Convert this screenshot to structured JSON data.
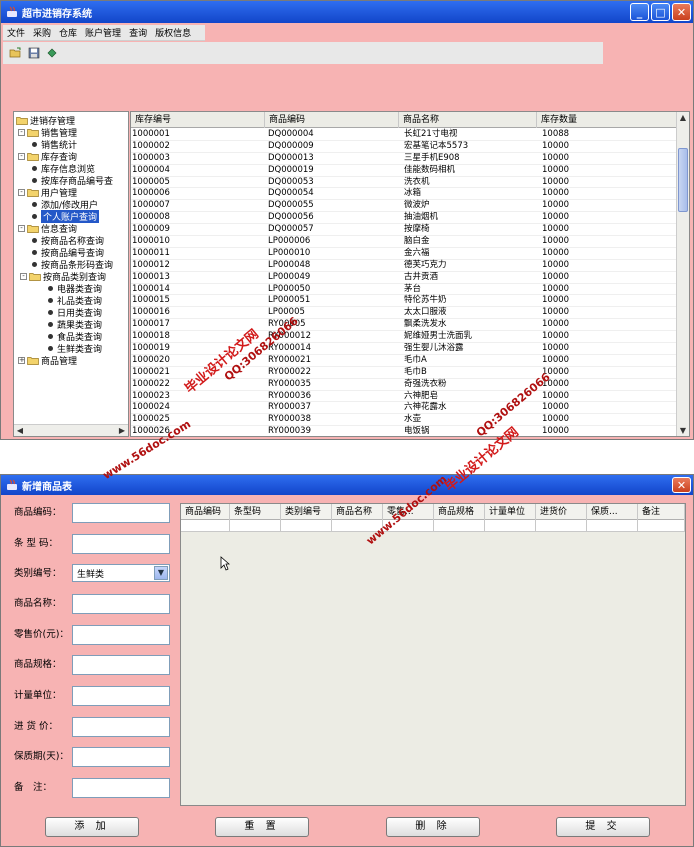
{
  "main_window": {
    "title": "超市进销存系统",
    "menu": [
      "文件",
      "采购",
      "仓库",
      "账户管理",
      "查询",
      "版权信息"
    ],
    "toolbar_icons": [
      "open-folder-icon",
      "save-icon",
      "refresh-icon"
    ],
    "tree": [
      {
        "label": "进销存管理",
        "level": 0,
        "type": "folder",
        "toggle": ""
      },
      {
        "label": "销售管理",
        "level": 1,
        "type": "folder",
        "toggle": "-"
      },
      {
        "label": "销售统计",
        "level": 2,
        "type": "leaf"
      },
      {
        "label": "库存查询",
        "level": 1,
        "type": "folder",
        "toggle": "-"
      },
      {
        "label": "库存信息浏览",
        "level": 2,
        "type": "leaf"
      },
      {
        "label": "按库存商品编号查",
        "level": 2,
        "type": "leaf"
      },
      {
        "label": "用户管理",
        "level": 1,
        "type": "folder",
        "toggle": "-"
      },
      {
        "label": "添加/修改用户",
        "level": 2,
        "type": "leaf"
      },
      {
        "label": "个人账户查询",
        "level": 2,
        "type": "leaf",
        "selected": true
      },
      {
        "label": "信息查询",
        "level": 1,
        "type": "folder",
        "toggle": "-"
      },
      {
        "label": "按商品名称查询",
        "level": 2,
        "type": "leaf"
      },
      {
        "label": "按商品编号查询",
        "level": 2,
        "type": "leaf"
      },
      {
        "label": "按商品条形码查询",
        "level": 2,
        "type": "leaf"
      },
      {
        "label": "按商品类别查询",
        "level": 2,
        "type": "folder",
        "toggle": "-"
      },
      {
        "label": "电器类查询",
        "level": 3,
        "type": "leaf"
      },
      {
        "label": "礼品类查询",
        "level": 3,
        "type": "leaf"
      },
      {
        "label": "日用类查询",
        "level": 3,
        "type": "leaf"
      },
      {
        "label": "蔬果类查询",
        "level": 3,
        "type": "leaf"
      },
      {
        "label": "食品类查询",
        "level": 3,
        "type": "leaf"
      },
      {
        "label": "生鲜类查询",
        "level": 3,
        "type": "leaf"
      },
      {
        "label": "商品管理",
        "level": 1,
        "type": "folder",
        "toggle": "+"
      }
    ],
    "table": {
      "columns": [
        "库存编号",
        "商品编码",
        "商品名称",
        "库存数量"
      ],
      "rows": [
        [
          "1000001",
          "DQ000004",
          "长虹21寸电视",
          "10088"
        ],
        [
          "1000002",
          "DQ000009",
          "宏基笔记本5573",
          "10000"
        ],
        [
          "1000003",
          "DQ000013",
          "三星手机E908",
          "10000"
        ],
        [
          "1000004",
          "DQ000019",
          "佳能数码相机",
          "10000"
        ],
        [
          "1000005",
          "DQ000053",
          "洗衣机",
          "10000"
        ],
        [
          "1000006",
          "DQ000054",
          "冰箱",
          "10000"
        ],
        [
          "1000007",
          "DQ000055",
          "微波炉",
          "10000"
        ],
        [
          "1000008",
          "DQ000056",
          "抽油烟机",
          "10000"
        ],
        [
          "1000009",
          "DQ000057",
          "按摩椅",
          "10000"
        ],
        [
          "1000010",
          "LP000006",
          "脑白金",
          "10000"
        ],
        [
          "1000011",
          "LP000010",
          "金六福",
          "10000"
        ],
        [
          "1000012",
          "LP000048",
          "德芙巧克力",
          "10000"
        ],
        [
          "1000013",
          "LP000049",
          "古井贡酒",
          "10000"
        ],
        [
          "1000014",
          "LP000050",
          "茅台",
          "10000"
        ],
        [
          "1000015",
          "LP000051",
          "特伦苏牛奶",
          "10000"
        ],
        [
          "1000016",
          "LP00005",
          "太太口服液",
          "10000"
        ],
        [
          "1000017",
          "RY00005",
          "飘柔洗发水",
          "10000"
        ],
        [
          "1000018",
          "RY000012",
          "妮维娅男士洗面乳",
          "10000"
        ],
        [
          "1000019",
          "RY000014",
          "强生婴儿沐浴露",
          "10000"
        ],
        [
          "1000020",
          "RY000021",
          "毛巾A",
          "10000"
        ],
        [
          "1000021",
          "RY000022",
          "毛巾B",
          "10000"
        ],
        [
          "1000022",
          "RY000035",
          "奇强洗衣粉",
          "10000"
        ],
        [
          "1000023",
          "RY000036",
          "六神肥皂",
          "10000"
        ],
        [
          "1000024",
          "RY000037",
          "六神花露水",
          "10000"
        ],
        [
          "1000025",
          "RY000038",
          "水壶",
          "10000"
        ],
        [
          "1000026",
          "RY000039",
          "电饭锅",
          "10000"
        ]
      ]
    }
  },
  "dialog": {
    "title": "新增商品表",
    "fields": [
      {
        "label": "商品编码：",
        "value": ""
      },
      {
        "label": "条 型 码：",
        "value": ""
      },
      {
        "label": "类别编号：",
        "value": "生鲜类",
        "type": "select"
      },
      {
        "label": "商品名称：",
        "value": ""
      },
      {
        "label": "零售价(元)：",
        "value": ""
      },
      {
        "label": "商品规格：",
        "value": ""
      },
      {
        "label": "计量单位：",
        "value": ""
      },
      {
        "label": "进 货 价：",
        "value": ""
      },
      {
        "label": "保质期(天)：",
        "value": ""
      },
      {
        "label": "备　注：",
        "value": ""
      }
    ],
    "grid_columns": [
      "商品编码",
      "条型码",
      "类别编号",
      "商品名称",
      "零售...",
      "商品规格",
      "计量单位",
      "进货价",
      "保质...",
      "备注"
    ],
    "buttons": [
      "添 加",
      "重 置",
      "删 除",
      "提 交"
    ]
  },
  "watermarks": [
    "毕业设计论文网",
    "www.56doc.com",
    "QQ:306826066"
  ]
}
